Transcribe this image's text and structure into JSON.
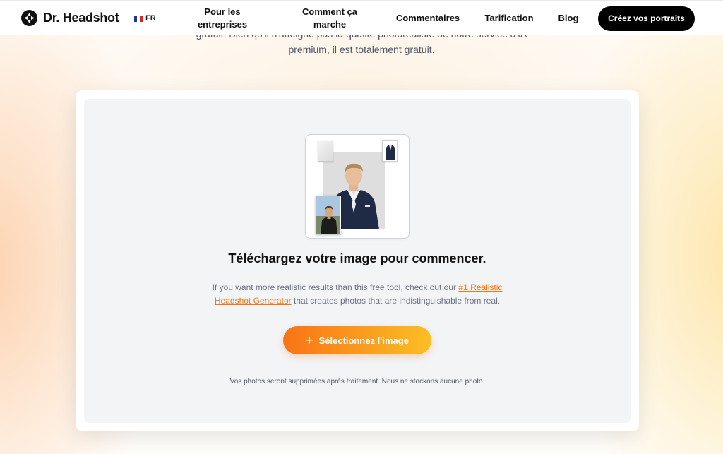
{
  "header": {
    "brand": "Dr. Headshot",
    "lang": "FR",
    "nav": {
      "business": "Pour les entreprises",
      "how": "Comment ça marche",
      "reviews": "Commentaires",
      "pricing": "Tarification",
      "blog": "Blog"
    },
    "cta": "Créez vos portraits"
  },
  "intro": {
    "line1": "gratuit. Bien qu'il n'atteigne pas la qualité photoréaliste de notre service d'IA",
    "line2": "premium, il est totalement gratuit."
  },
  "upload": {
    "title": "Téléchargez votre image pour commencer.",
    "desc_before": "If you want more realistic results than this free tool, check out our ",
    "desc_link": "#1 Realistic Headshot Generator",
    "desc_after": " that creates photos that are indistinguishable from real.",
    "button": "Sélectionnez l'image",
    "privacy": "Vos photos seront supprimées après traitement. Nous ne stockons aucune photo."
  },
  "colors": {
    "accent_start": "#f97316",
    "accent_end": "#fbbf24",
    "link": "#f97316",
    "cta_bg": "#000000"
  },
  "icons": {
    "logo": "aperture-icon",
    "flag": "france-flag-icon",
    "button": "plus-icon"
  }
}
